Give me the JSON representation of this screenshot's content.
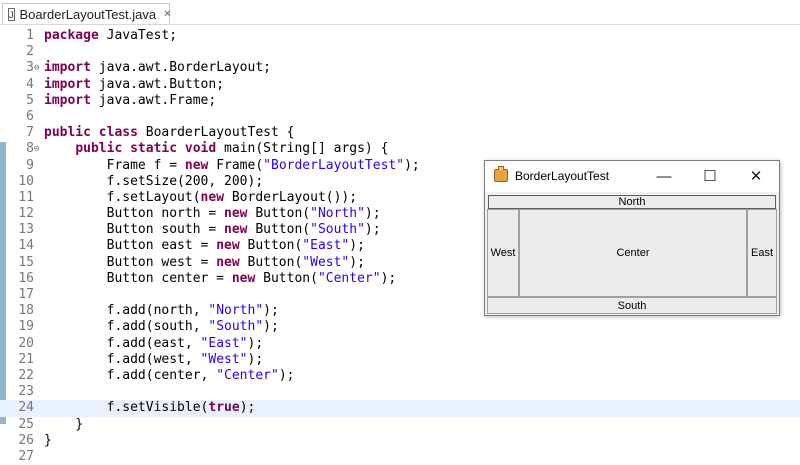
{
  "editor": {
    "tab": {
      "title": "BoarderLayoutTest.java",
      "icon": "java-file-icon",
      "close": "✕"
    },
    "lines": [
      {
        "n": "1",
        "fold": "",
        "tokens": [
          [
            "kw",
            "package"
          ],
          [
            "",
            " JavaTest;"
          ]
        ]
      },
      {
        "n": "2",
        "fold": "",
        "tokens": []
      },
      {
        "n": "3",
        "fold": "⊖",
        "tokens": [
          [
            "kw",
            "import"
          ],
          [
            "",
            " java.awt.BorderLayout;"
          ]
        ]
      },
      {
        "n": "4",
        "fold": "",
        "tokens": [
          [
            "kw",
            "import"
          ],
          [
            "",
            " java.awt.Button;"
          ]
        ]
      },
      {
        "n": "5",
        "fold": "",
        "tokens": [
          [
            "kw",
            "import"
          ],
          [
            "",
            " java.awt.Frame;"
          ]
        ]
      },
      {
        "n": "6",
        "fold": "",
        "tokens": []
      },
      {
        "n": "7",
        "fold": "",
        "tokens": [
          [
            "kw",
            "public"
          ],
          [
            "",
            " "
          ],
          [
            "kw",
            "class"
          ],
          [
            "",
            " BoarderLayoutTest {"
          ]
        ]
      },
      {
        "n": "8",
        "fold": "⊖",
        "tokens": [
          [
            "",
            "    "
          ],
          [
            "kw",
            "public"
          ],
          [
            "",
            " "
          ],
          [
            "kw",
            "static"
          ],
          [
            "",
            " "
          ],
          [
            "kw",
            "void"
          ],
          [
            "",
            " main(String[] args) {"
          ]
        ]
      },
      {
        "n": "9",
        "fold": "",
        "tokens": [
          [
            "",
            "        Frame f = "
          ],
          [
            "kw",
            "new"
          ],
          [
            "",
            " Frame("
          ],
          [
            "str",
            "\"BorderLayoutTest\""
          ],
          [
            "",
            ");"
          ]
        ]
      },
      {
        "n": "10",
        "fold": "",
        "tokens": [
          [
            "",
            "        f.setSize(200, 200);"
          ]
        ]
      },
      {
        "n": "11",
        "fold": "",
        "tokens": [
          [
            "",
            "        f.setLayout("
          ],
          [
            "kw",
            "new"
          ],
          [
            "",
            " BorderLayout());"
          ]
        ]
      },
      {
        "n": "12",
        "fold": "",
        "tokens": [
          [
            "",
            "        Button north = "
          ],
          [
            "kw",
            "new"
          ],
          [
            "",
            " Button("
          ],
          [
            "str",
            "\"North\""
          ],
          [
            "",
            ");"
          ]
        ]
      },
      {
        "n": "13",
        "fold": "",
        "tokens": [
          [
            "",
            "        Button south = "
          ],
          [
            "kw",
            "new"
          ],
          [
            "",
            " Button("
          ],
          [
            "str",
            "\"South\""
          ],
          [
            "",
            ");"
          ]
        ]
      },
      {
        "n": "14",
        "fold": "",
        "tokens": [
          [
            "",
            "        Button east = "
          ],
          [
            "kw",
            "new"
          ],
          [
            "",
            " Button("
          ],
          [
            "str",
            "\"East\""
          ],
          [
            "",
            ");"
          ]
        ]
      },
      {
        "n": "15",
        "fold": "",
        "tokens": [
          [
            "",
            "        Button west = "
          ],
          [
            "kw",
            "new"
          ],
          [
            "",
            " Button("
          ],
          [
            "str",
            "\"West\""
          ],
          [
            "",
            ");"
          ]
        ]
      },
      {
        "n": "16",
        "fold": "",
        "tokens": [
          [
            "",
            "        Button center = "
          ],
          [
            "kw",
            "new"
          ],
          [
            "",
            " Button("
          ],
          [
            "str",
            "\"Center\""
          ],
          [
            "",
            ");"
          ]
        ]
      },
      {
        "n": "17",
        "fold": "",
        "tokens": []
      },
      {
        "n": "18",
        "fold": "",
        "tokens": [
          [
            "",
            "        f.add(north, "
          ],
          [
            "str",
            "\"North\""
          ],
          [
            "",
            ");"
          ]
        ]
      },
      {
        "n": "19",
        "fold": "",
        "tokens": [
          [
            "",
            "        f.add(south, "
          ],
          [
            "str",
            "\"South\""
          ],
          [
            "",
            ");"
          ]
        ]
      },
      {
        "n": "20",
        "fold": "",
        "tokens": [
          [
            "",
            "        f.add(east, "
          ],
          [
            "str",
            "\"East\""
          ],
          [
            "",
            ");"
          ]
        ]
      },
      {
        "n": "21",
        "fold": "",
        "tokens": [
          [
            "",
            "        f.add(west, "
          ],
          [
            "str",
            "\"West\""
          ],
          [
            "",
            ");"
          ]
        ]
      },
      {
        "n": "22",
        "fold": "",
        "tokens": [
          [
            "",
            "        f.add(center, "
          ],
          [
            "str",
            "\"Center\""
          ],
          [
            "",
            ");"
          ]
        ]
      },
      {
        "n": "23",
        "fold": "",
        "tokens": []
      },
      {
        "n": "24",
        "fold": "",
        "current": true,
        "tokens": [
          [
            "",
            "        f.setVisible("
          ],
          [
            "kw",
            "true"
          ],
          [
            "",
            ");"
          ]
        ]
      },
      {
        "n": "25",
        "fold": "",
        "tokens": [
          [
            "",
            "    }"
          ]
        ]
      },
      {
        "n": "26",
        "fold": "",
        "tokens": [
          [
            "",
            "}"
          ]
        ]
      },
      {
        "n": "27",
        "fold": "",
        "tokens": []
      }
    ],
    "colors": {
      "keyword": "#7f0055",
      "string": "#2a00ff",
      "current_line": "#e8f2fe",
      "marker": "#8fb5cf"
    }
  },
  "frame_window": {
    "title": "BorderLayoutTest",
    "app_icon": "java-cup-icon",
    "controls": {
      "minimize": "—",
      "maximize": "☐",
      "close": "✕"
    },
    "buttons": {
      "north": "North",
      "south": "South",
      "east": "East",
      "west": "West",
      "center": "Center"
    }
  }
}
